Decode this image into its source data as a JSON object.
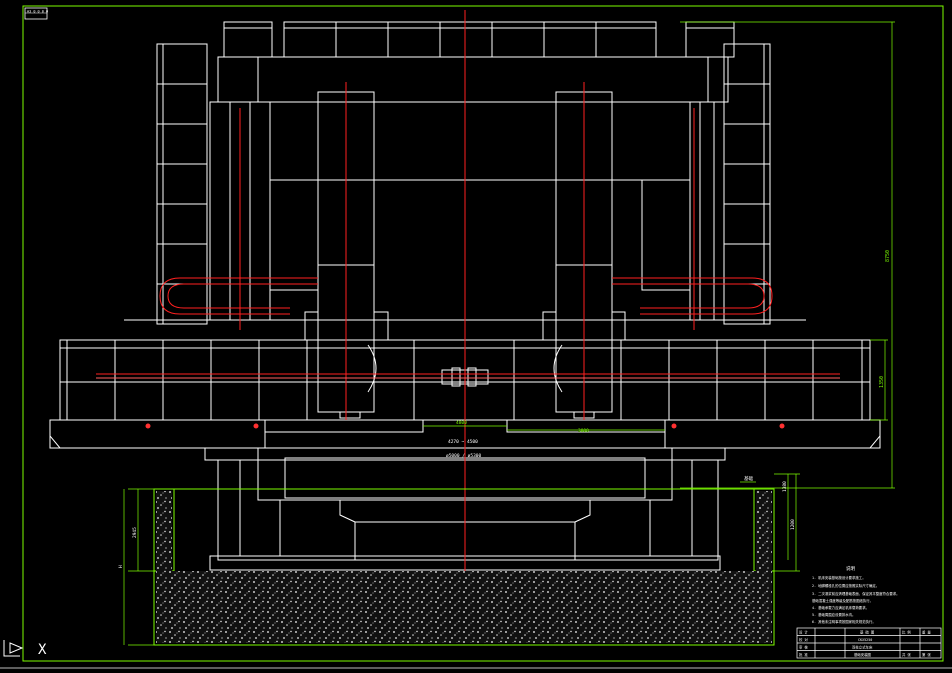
{
  "drawing": {
    "stamp_top_left": "A3 0 0 0 0",
    "dim_overall_height": "8750",
    "dim_crossbeam_height": "1350",
    "dim_table_width": "4800",
    "dim_right_width": "3000",
    "dim_table_span": "4270 ~ 4500",
    "dim_table_dia": "ø5000 / ø5300",
    "dim_pit_depth": "2945",
    "dim_pit_right": "1200",
    "dim_base_right": "1380",
    "dim_left_h": "H",
    "label_pit": "基础",
    "notes_title": "说明",
    "notes": [
      "1. 机床安装基础按设计要求施工。",
      "2. 地脚螺栓孔的位置应按照实际尺寸确定。",
      "3. 二次灌浆前应清理基础表面，保证其平整度符合要求。",
      "   基础混凝土强度等级及配筋按图纸执行。",
      "4. 基础承载力应满足机床载荷要求。",
      "5. 基础周围应设置排水沟。",
      "6. 其他未注明事项按国家相关规范执行。"
    ],
    "title_block": {
      "rows": [
        [
          "设 计",
          "",
          "基 础 图",
          "比 例",
          "重 量"
        ],
        [
          "校 对",
          "",
          "CKX5250",
          "",
          ""
        ],
        [
          "审 核",
          "",
          "双柱立式车床",
          "",
          ""
        ],
        [
          "批 准",
          "",
          "基础安装图",
          "共 张",
          "第 张"
        ]
      ]
    },
    "cursor_label": "X"
  }
}
